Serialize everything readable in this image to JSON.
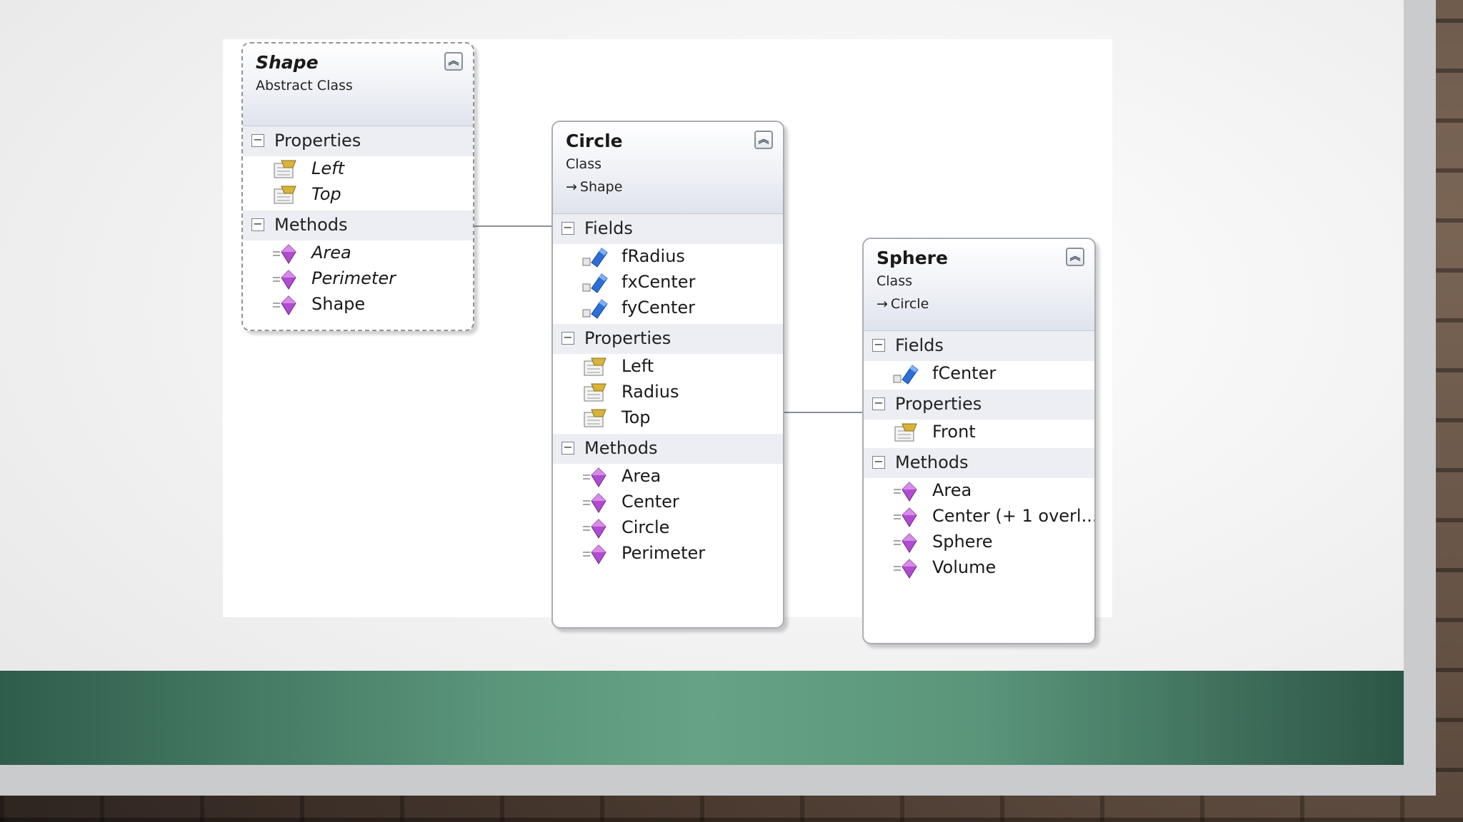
{
  "classes": {
    "shape": {
      "name": "Shape",
      "kind": "Abstract Class",
      "sections": {
        "properties": {
          "label": "Properties",
          "members": [
            "Left",
            "Top"
          ]
        },
        "methods": {
          "label": "Methods",
          "members": [
            "Area",
            "Perimeter",
            "Shape"
          ]
        }
      }
    },
    "circle": {
      "name": "Circle",
      "kind": "Class",
      "base": "Shape",
      "sections": {
        "fields": {
          "label": "Fields",
          "members": [
            "fRadius",
            "fxCenter",
            "fyCenter"
          ]
        },
        "properties": {
          "label": "Properties",
          "members": [
            "Left",
            "Radius",
            "Top"
          ]
        },
        "methods": {
          "label": "Methods",
          "members": [
            "Area",
            "Center",
            "Circle",
            "Perimeter"
          ]
        }
      }
    },
    "sphere": {
      "name": "Sphere",
      "kind": "Class",
      "base": "Circle",
      "sections": {
        "fields": {
          "label": "Fields",
          "members": [
            "fCenter"
          ]
        },
        "properties": {
          "label": "Properties",
          "members": [
            "Front"
          ]
        },
        "methods": {
          "label": "Methods",
          "members": [
            "Area",
            "Center (+ 1 overl...",
            "Sphere",
            "Volume"
          ]
        }
      }
    }
  },
  "colors": {
    "box_border": "#a9adb3",
    "section_bg": "#eceef3",
    "method_icon": "#b04ccf",
    "field_icon": "#2d6fd6",
    "property_icon": "#d9b43a",
    "green_band": "#5a957a"
  },
  "icons": {
    "collapse": "double-chevron-up-icon",
    "field": "field-icon",
    "property": "property-icon",
    "method": "method-icon",
    "inherits": "inheritance-arrow-icon"
  }
}
